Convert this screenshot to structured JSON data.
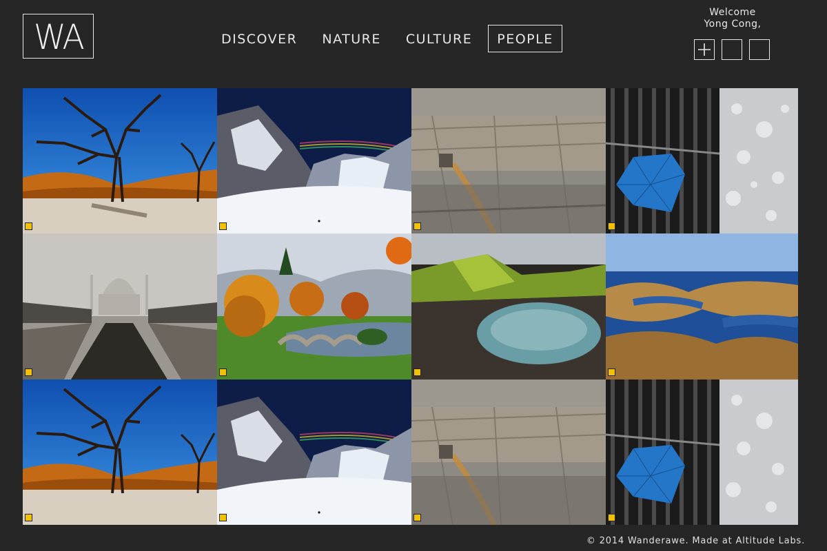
{
  "brand": {
    "logo_text": "WA"
  },
  "nav": {
    "items": [
      {
        "label": "DISCOVER",
        "active": false
      },
      {
        "label": "NATURE",
        "active": false
      },
      {
        "label": "CULTURE",
        "active": false
      },
      {
        "label": "PEOPLE",
        "active": true
      }
    ]
  },
  "user": {
    "greeting": "Welcome",
    "name": "Yong Cong,"
  },
  "actions": [
    {
      "icon": "plus-icon"
    },
    {
      "icon": "blank-box-icon"
    },
    {
      "icon": "blank-box-icon"
    }
  ],
  "gallery": {
    "tiles": [
      {
        "scene": "dead-tree-desert"
      },
      {
        "scene": "snowy-mountain-rainbow"
      },
      {
        "scene": "aerial-city"
      },
      {
        "scene": "umbrella-rain"
      },
      {
        "scene": "foggy-taj-mahal"
      },
      {
        "scene": "autumn-park-bridge"
      },
      {
        "scene": "green-crater-lake"
      },
      {
        "scene": "aerial-wetlands"
      },
      {
        "scene": "dead-tree-desert"
      },
      {
        "scene": "snowy-mountain-rainbow"
      },
      {
        "scene": "aerial-city"
      },
      {
        "scene": "umbrella-rain"
      }
    ]
  },
  "footer": {
    "text": "© 2014 Wanderawe. Made at Altitude Labs."
  }
}
